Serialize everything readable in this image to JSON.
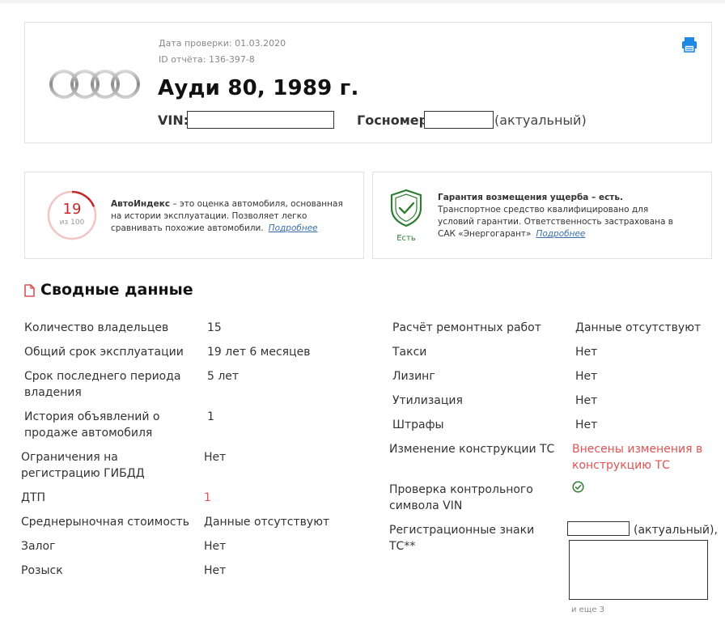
{
  "header": {
    "check_date": "Дата проверки: 01.03.2020",
    "report_id": "ID отчёта: 136-397-8",
    "title": "Ауди 80, 1989 г.",
    "vin_label": "VIN:",
    "gos_label": "Госномер:",
    "gos_status": "(актуальный)"
  },
  "autoindex": {
    "score": "19",
    "scale": "из 100",
    "term": "АвтоИндекс",
    "text": " – это оценка автомобиля, основанная на истории эксплуатации. Позволяет легко сравнивать похожие автомобили.",
    "more": "Подробнее",
    "score_fraction": 0.19
  },
  "guarantee": {
    "badge": "Есть",
    "term": "Гарантия возмещения ущерба – есть.",
    "text": " Транспортное средство квалифицировано для условий гарантии. Ответственность застрахована в САК «Энергогарант»",
    "more": "Подробнее"
  },
  "summary": {
    "title": "Сводные данные",
    "left": [
      {
        "label": "Количество владельцев",
        "value": "15"
      },
      {
        "label": "Общий срок эксплуатации",
        "value": "19 лет 6 месяцев"
      },
      {
        "label": "Срок последнего периода владения",
        "value": "5 лет"
      },
      {
        "label": "История объявлений о продаже автомобиля",
        "value": "1"
      },
      {
        "label": "Ограничения на регистрацию ГИБДД",
        "value": "Нет"
      },
      {
        "label": "ДТП",
        "value": "1"
      },
      {
        "label": "Среднерыночная стоимость",
        "value": "Данные отсутствуют"
      },
      {
        "label": "Залог",
        "value": "Нет"
      },
      {
        "label": "Розыск",
        "value": "Нет"
      }
    ],
    "right": [
      {
        "label": "Расчёт ремонтных работ",
        "value": "Данные отсутствуют"
      },
      {
        "label": "Такси",
        "value": "Нет"
      },
      {
        "label": "Лизинг",
        "value": "Нет"
      },
      {
        "label": "Утилизация",
        "value": "Нет"
      },
      {
        "label": "Штрафы",
        "value": "Нет"
      },
      {
        "label": "Изменение конструкции ТС",
        "value": "Внесены изменения в конструкцию ТС"
      },
      {
        "label": "Проверка контрольного символа VIN",
        "value": ""
      },
      {
        "label": "Регистрационные знаки ТС**",
        "value": "(актуальный),"
      }
    ],
    "and_more": "и еще 3"
  },
  "colors": {
    "accent": "#c62828",
    "link": "#3a6fb0",
    "ok": "#2e7d32",
    "warning": "#e05252"
  },
  "icons": {
    "print": "printer-icon",
    "doc": "document-icon",
    "shield": "shield-check-icon",
    "vin_ok": "check-circle-icon"
  }
}
